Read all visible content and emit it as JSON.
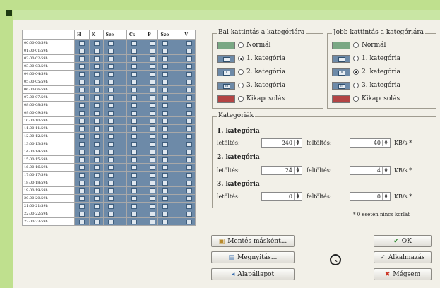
{
  "schedule": {
    "days": [
      "H",
      "K",
      "Sze",
      "Cs",
      "P",
      "Szo",
      "V"
    ],
    "hours": [
      "00:00-00:59h",
      "01:00-01:59h",
      "02:00-02:59h",
      "03:00-03:59h",
      "04:00-04:59h",
      "05:00-05:59h",
      "06:00-06:59h",
      "07:00-07:59h",
      "08:00-08:59h",
      "09:00-09:59h",
      "10:00-10:59h",
      "11:00-11:59h",
      "12:00-12:59h",
      "13:00-13:59h",
      "14:00-14:59h",
      "15:00-15:59h",
      "16:00-16:59h",
      "17:00-17:59h",
      "18:00-18:59h",
      "19:00-19:59h",
      "20:00-20:59h",
      "21:00-21:59h",
      "22:00-22:59h",
      "23:00-23:59h"
    ],
    "cell_color": "#6d8aa8"
  },
  "left_click": {
    "title": "Bal kattintás a kategóriára",
    "options": [
      {
        "label": "Normál",
        "swatch": "#7aa884",
        "mark": "",
        "selected": false
      },
      {
        "label": "1. kategória",
        "swatch": "#6d8aa8",
        "mark": "",
        "selected": true
      },
      {
        "label": "2. kategória",
        "swatch": "#6d8aa8",
        "mark": "II",
        "selected": false
      },
      {
        "label": "3. kategória",
        "swatch": "#6d8aa8",
        "mark": "III",
        "selected": false
      },
      {
        "label": "Kikapcsolás",
        "swatch": "#b34444",
        "mark": "",
        "selected": false
      }
    ]
  },
  "right_click": {
    "title": "Jobb kattintás a kategóriára",
    "options": [
      {
        "label": "Normál",
        "swatch": "#7aa884",
        "mark": "",
        "selected": false
      },
      {
        "label": "1. kategória",
        "swatch": "#6d8aa8",
        "mark": "",
        "selected": false
      },
      {
        "label": "2. kategória",
        "swatch": "#6d8aa8",
        "mark": "II",
        "selected": true
      },
      {
        "label": "3. kategória",
        "swatch": "#6d8aa8",
        "mark": "III",
        "selected": false
      },
      {
        "label": "Kikapcsolás",
        "swatch": "#b34444",
        "mark": "",
        "selected": false
      }
    ]
  },
  "categories": {
    "title": "Kategóriák",
    "download_label": "letöltés:",
    "upload_label": "feltöltés:",
    "unit": "KB/s *",
    "items": [
      {
        "name": "1. kategória",
        "download": "240",
        "upload": "40"
      },
      {
        "name": "2. kategória",
        "download": "24",
        "upload": "4"
      },
      {
        "name": "3. kategória",
        "download": "0",
        "upload": "0"
      }
    ],
    "note": "* 0 esetén nincs korlát"
  },
  "buttons": {
    "save_as": "Mentés másként...",
    "open": "Megnyitás...",
    "default": "Alapállapot",
    "ok": "OK",
    "apply": "Alkalmazás",
    "cancel": "Mégsem"
  }
}
